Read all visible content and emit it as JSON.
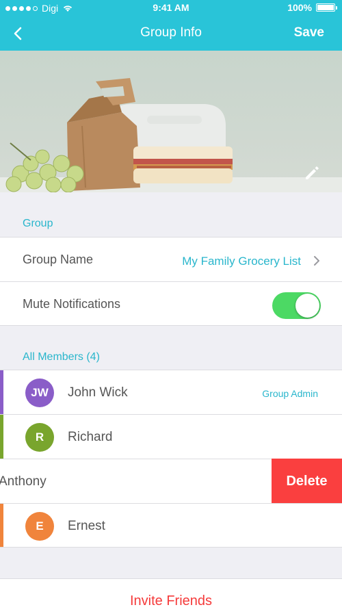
{
  "status_bar": {
    "carrier": "Digi",
    "time": "9:41 AM",
    "battery": "100%"
  },
  "nav": {
    "title": "Group Info",
    "save_label": "Save"
  },
  "sections": {
    "group_label": "Group",
    "members_label": "All Members (4)"
  },
  "group": {
    "name_label": "Group Name",
    "name_value": "My Family Grocery List",
    "mute_label": "Mute Notifications",
    "mute_enabled": true
  },
  "members": [
    {
      "initials": "JW",
      "name": "John Wick",
      "role": "Group Admin",
      "color": "#8a5dc8"
    },
    {
      "initials": "R",
      "name": "Richard",
      "role": "",
      "color": "#79a52d"
    },
    {
      "initials": "",
      "name": "Anthony",
      "role": "",
      "color": "#29b6cc",
      "swipe_action": "Delete"
    },
    {
      "initials": "E",
      "name": "Ernest",
      "role": "",
      "color": "#f0843c"
    }
  ],
  "footer": {
    "invite_label": "Invite Friends"
  },
  "colors": {
    "accent": "#29c4d8",
    "link": "#29b6cc",
    "toggle_on": "#4cd964",
    "danger": "#fa3f3f",
    "invite": "#f53a3a"
  },
  "icons": [
    "back-arrow-icon",
    "wifi-icon",
    "battery-icon",
    "pencil-icon",
    "chevron-right-icon"
  ]
}
